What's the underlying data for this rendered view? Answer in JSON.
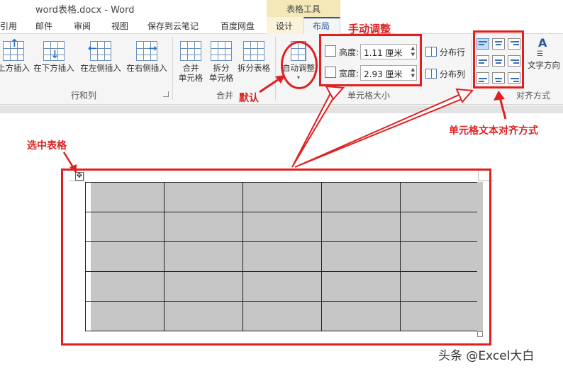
{
  "app": {
    "window_title": "word表格.docx - Word",
    "context_group": "表格工具"
  },
  "tabs": [
    {
      "label": "引用"
    },
    {
      "label": "邮件"
    },
    {
      "label": "审阅"
    },
    {
      "label": "视图"
    },
    {
      "label": "保存到云笔记"
    },
    {
      "label": "百度网盘"
    },
    {
      "label": "设计"
    },
    {
      "label": "布局",
      "active": true
    }
  ],
  "ribbon": {
    "rows_cols": {
      "label": "行和列",
      "buttons": [
        "上方插入",
        "在下方插入",
        "在左侧插入",
        "在右侧插入"
      ]
    },
    "merge": {
      "label": "合并",
      "merge_cells": [
        "合并",
        "单元格"
      ],
      "split_cells": [
        "拆分",
        "单元格"
      ],
      "split_table": "拆分表格"
    },
    "autofit": {
      "label": "自动调整"
    },
    "cell_size": {
      "label": "单元格大小",
      "height_label": "高度:",
      "height_value": "1.11 厘米",
      "width_label": "宽度:",
      "width_value": "2.93 厘米",
      "distribute_rows": "分布行",
      "distribute_cols": "分布列"
    },
    "alignment": {
      "label": "对齐方式",
      "text_direction": "文字方向",
      "selected_cell": "top-left"
    }
  },
  "table": {
    "rows": 5,
    "cols": 5
  },
  "annotations": {
    "manual_adjust": "手动调整",
    "default": "默认",
    "cell_text_alignment": "单元格文本对齐方式",
    "select_table": "选中表格",
    "color": "#e02020"
  },
  "watermark": "头条 @Excel大白"
}
